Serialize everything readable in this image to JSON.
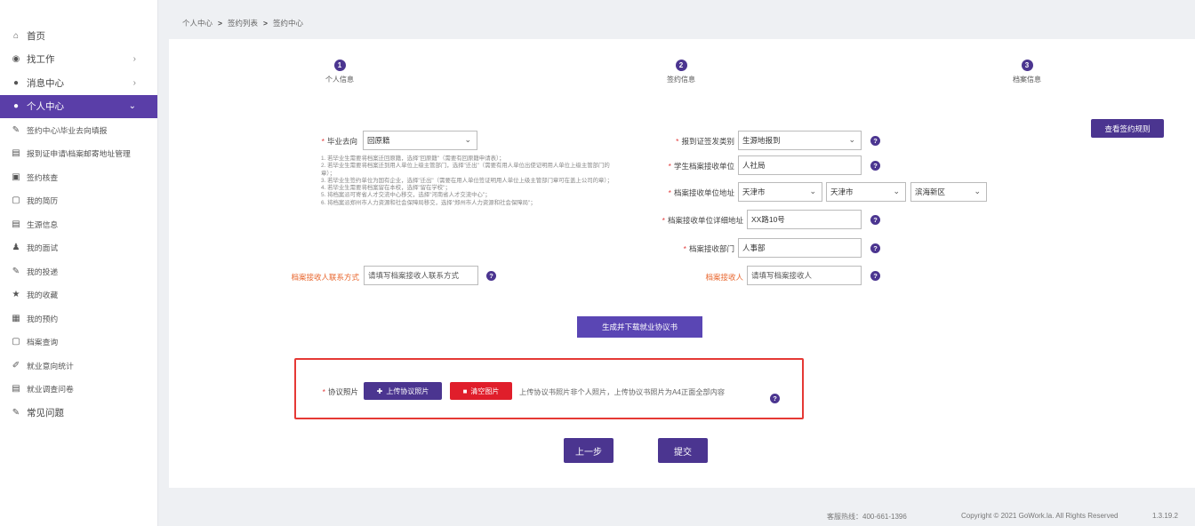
{
  "sidebar": {
    "items": [
      {
        "label": "首页",
        "icon": "home-icon",
        "glyph": "⌂"
      },
      {
        "label": "找工作",
        "icon": "eye-icon",
        "glyph": "◉",
        "arrow": "›"
      },
      {
        "label": "消息中心",
        "icon": "chat-icon",
        "glyph": "●",
        "arrow": "›"
      },
      {
        "label": "个人中心",
        "icon": "user-circle-icon",
        "glyph": "●",
        "arrow": "⌄"
      },
      {
        "label": "签约中心\\毕业去向填报",
        "icon": "edit-icon",
        "glyph": "✎"
      },
      {
        "label": "报到证申请\\档案邮寄地址管理",
        "icon": "card-icon",
        "glyph": "▤"
      },
      {
        "label": "签约核查",
        "icon": "check-doc-icon",
        "glyph": "▣"
      },
      {
        "label": "我的简历",
        "icon": "resume-icon",
        "glyph": "▢"
      },
      {
        "label": "生源信息",
        "icon": "info-icon",
        "glyph": "▤"
      },
      {
        "label": "我的面试",
        "icon": "interview-icon",
        "glyph": "♟"
      },
      {
        "label": "我的投递",
        "icon": "send-icon",
        "glyph": "✎"
      },
      {
        "label": "我的收藏",
        "icon": "star-icon",
        "glyph": "★"
      },
      {
        "label": "我的预约",
        "icon": "calendar-icon",
        "glyph": "▦"
      },
      {
        "label": "档案查询",
        "icon": "search-doc-icon",
        "glyph": "▢"
      },
      {
        "label": "就业意向统计",
        "icon": "pen-icon",
        "glyph": "✐"
      },
      {
        "label": "就业调查问卷",
        "icon": "survey-icon",
        "glyph": "▤"
      },
      {
        "label": "常见问题",
        "icon": "faq-icon",
        "glyph": "✎"
      }
    ]
  },
  "breadcrumb": {
    "home": "个人中心",
    "sep": ">",
    "list": "签约列表",
    "current": "签约中心"
  },
  "steps": [
    {
      "num": "1",
      "label": "个人信息"
    },
    {
      "num": "2",
      "label": "签约信息"
    },
    {
      "num": "3",
      "label": "档案信息"
    }
  ],
  "rules_button": "查看签约规则",
  "form": {
    "destination_label": "毕业去向",
    "destination_value": "回原籍",
    "notes": [
      "1. 若毕业生需要将档案迁回原籍，选择\"回原籍\"（需要有回原籍申请表）；",
      "2. 若毕业生需要将档案迁到用人单位上级主管部门，选择\"迁出\"（需要有用人单位出使证明用人单位上级主管部门的章）；",
      "3. 若毕业生签约单位为国有企业，选择\"迁出\"（需要在用人单位签证明用人单位上级主管部门章可在盖上公司的章）；",
      "4. 若毕业生需要将档案留在本校，选择\"留在学校\"；",
      "5. 将档案派可寄省人才交流中心移交，选择\"河南省人才交流中心\"；",
      "6. 将档案派郑州市人力资源和社会保障局移交，选择\"郑州市人力资源和社会保障局\"；"
    ],
    "report_type_label": "报到证签发类别",
    "report_type_value": "生源地报到",
    "archive_unit_label": "学生档案接收单位",
    "archive_unit_value": "人社局",
    "archive_address_label": "档案接收单位地址",
    "province": "天津市",
    "city": "天津市",
    "district": "滨海新区",
    "detail_address_label": "档案接收单位详细地址",
    "detail_address_value": "XX路10号",
    "dept_label": "档案接收部门",
    "dept_value": "人事部",
    "contact_label": "档案接收人联系方式",
    "contact_placeholder": "请填写档案接收人联系方式",
    "receiver_label": "档案接收人",
    "receiver_placeholder": "请填写档案接收人",
    "required_mark": "*",
    "help_glyph": "?",
    "select_chevron": "⌄"
  },
  "generate_button": "生成并下载就业协议书",
  "upload": {
    "label": "协议照片",
    "upload_button": "上传协议照片",
    "upload_glyph": "✚",
    "clear_button": "清空图片",
    "clear_glyph": "■",
    "note": "上传协议书照片非个人照片，上传协议书照片为A4正面全部内容"
  },
  "actions": {
    "prev": "上一步",
    "submit": "提交"
  },
  "footer": {
    "hotline": "客服热线：400-661-1396",
    "copyright": "Copyright © 2021 GoWork.la. All Rights Reserved",
    "version": "1.3.19.2"
  },
  "colors": {
    "primary": "#4b3590",
    "danger": "#e53935",
    "required": "#e23b3b",
    "orange_label": "#e8652c"
  }
}
